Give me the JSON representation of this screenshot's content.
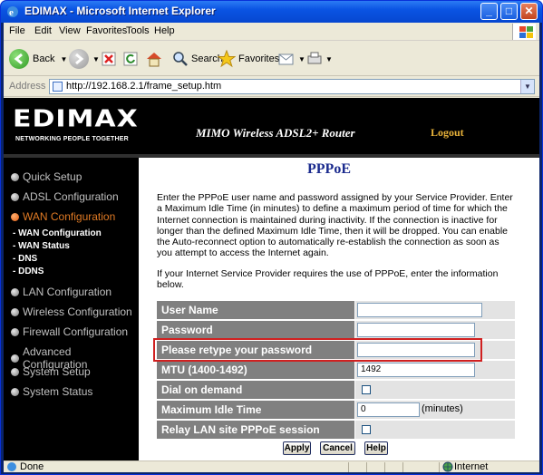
{
  "window": {
    "title": "EDIMAX - Microsoft Internet Explorer"
  },
  "menubar": {
    "items": [
      "File",
      "Edit",
      "View",
      "Favorites",
      "Tools",
      "Help"
    ]
  },
  "toolbar": {
    "back_label": "Back",
    "search_label": "Search",
    "favorites_label": "Favorites"
  },
  "address": {
    "label": "Address",
    "url": "http://192.168.2.1/frame_setup.htm"
  },
  "banner": {
    "logo": "EDIMAX",
    "tagline": "NETWORKING PEOPLE TOGETHER",
    "product": "MIMO Wireless ADSL2+ Router",
    "logout": "Logout"
  },
  "sidebar": {
    "items": [
      {
        "label": "Quick Setup",
        "active": false
      },
      {
        "label": "ADSL Configuration",
        "active": false
      },
      {
        "label": "WAN Configuration",
        "active": true
      },
      {
        "label": "LAN Configuration",
        "active": false
      },
      {
        "label": "Wireless Configuration",
        "active": false
      },
      {
        "label": "Firewall Configuration",
        "active": false
      },
      {
        "label": "Advanced Configuration",
        "active": false
      },
      {
        "label": "System Setup",
        "active": false
      },
      {
        "label": "System Status",
        "active": false
      }
    ],
    "subitems": [
      "- WAN Configuration",
      "- WAN Status",
      "- DNS",
      "- DDNS"
    ]
  },
  "main": {
    "title": "PPPoE",
    "intro": "Enter the PPPoE user name and password assigned by your Service Provider. Enter a Maximum Idle Time (in minutes) to define a maximum period of time for which the Internet connection is maintained during inactivity. If the connection is inactive for longer than the defined Maximum Idle Time, then it will be dropped. You can enable the Auto-reconnect option to automatically re-establish the connection as soon as you attempt to access the Internet again.",
    "note": "If your Internet Service Provider requires the use of PPPoE, enter the information below.",
    "fields": {
      "username_label": "User Name",
      "username_value": "",
      "password_label": "Password",
      "password_value": "",
      "retype_label": "Please retype your password",
      "retype_value": "",
      "mtu_label": "MTU (1400-1492)",
      "mtu_value": "1492",
      "dial_label": "Dial on demand",
      "dial_checked": false,
      "idle_label": "Maximum Idle Time",
      "idle_value": "0",
      "idle_unit": "(minutes)",
      "relay_label": "Relay LAN site PPPoE session",
      "relay_checked": false
    },
    "buttons": {
      "apply": "Apply",
      "cancel": "Cancel",
      "help": "Help"
    }
  },
  "status": {
    "text": "Done",
    "zone": "Internet"
  },
  "colors": {
    "accent_orange": "#e07a24",
    "title_blue": "#1b2b8e",
    "label_gray": "#808080",
    "highlight_red": "#d02020"
  }
}
